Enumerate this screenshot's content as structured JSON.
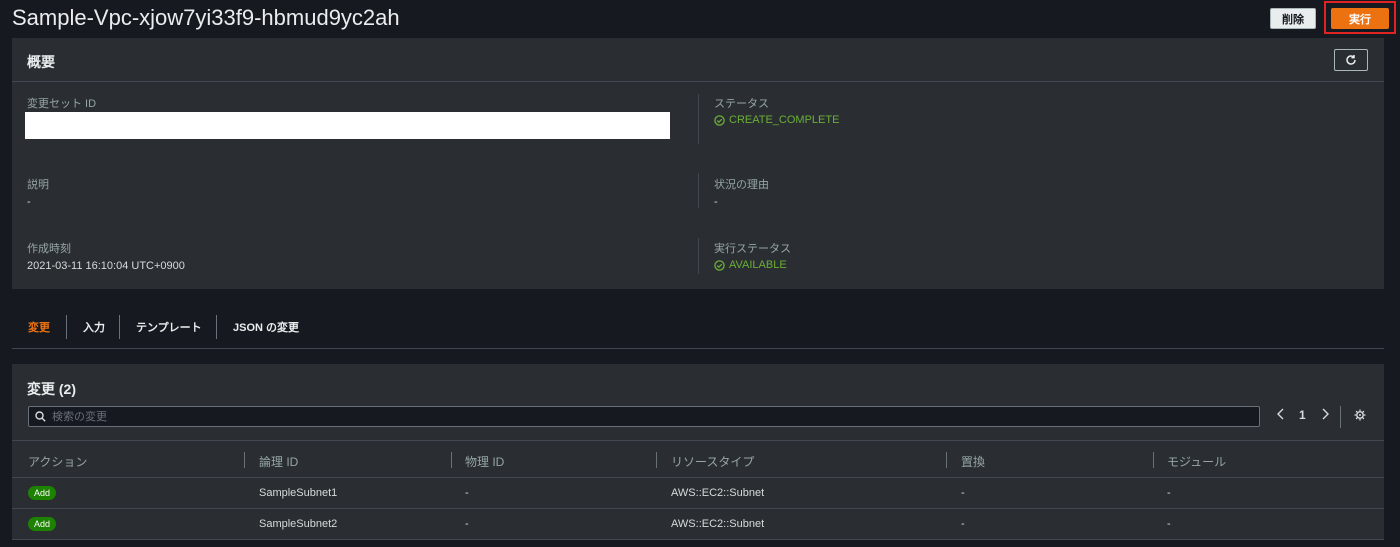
{
  "page": {
    "title": "Sample-Vpc-xjow7yi33f9-hbmud9yc2ah"
  },
  "actions": {
    "delete_label": "削除",
    "execute_label": "実行"
  },
  "overview": {
    "title": "概要",
    "refresh_icon": "refresh-icon",
    "changeset_id_label": "変更セット ID",
    "status_label": "ステータス",
    "status_value": "CREATE_COMPLETE",
    "description_label": "説明",
    "description_value": "-",
    "status_reason_label": "状況の理由",
    "status_reason_value": "-",
    "created_label": "作成時刻",
    "created_value": "2021-03-11 16:10:04 UTC+0900",
    "exec_status_label": "実行ステータス",
    "exec_status_value": "AVAILABLE"
  },
  "tabs": [
    {
      "label": "変更",
      "active": true
    },
    {
      "label": "入力",
      "active": false
    },
    {
      "label": "テンプレート",
      "active": false
    },
    {
      "label": "JSON の変更",
      "active": false
    }
  ],
  "changes": {
    "title": "変更 (2)",
    "search_placeholder": "検索の変更",
    "page_number": "1",
    "columns": [
      "アクション",
      "論理 ID",
      "物理 ID",
      "リソースタイプ",
      "置換",
      "モジュール"
    ],
    "rows": [
      {
        "action": "Add",
        "logical_id": "SampleSubnet1",
        "physical_id": "-",
        "resource_type": "AWS::EC2::Subnet",
        "replacement": "-",
        "module": "-"
      },
      {
        "action": "Add",
        "logical_id": "SampleSubnet2",
        "physical_id": "-",
        "resource_type": "AWS::EC2::Subnet",
        "replacement": "-",
        "module": "-"
      }
    ]
  },
  "colors": {
    "accent": "#ec7211",
    "success": "#6aaf35",
    "badge": "#1d8102",
    "highlight": "#e02424"
  }
}
